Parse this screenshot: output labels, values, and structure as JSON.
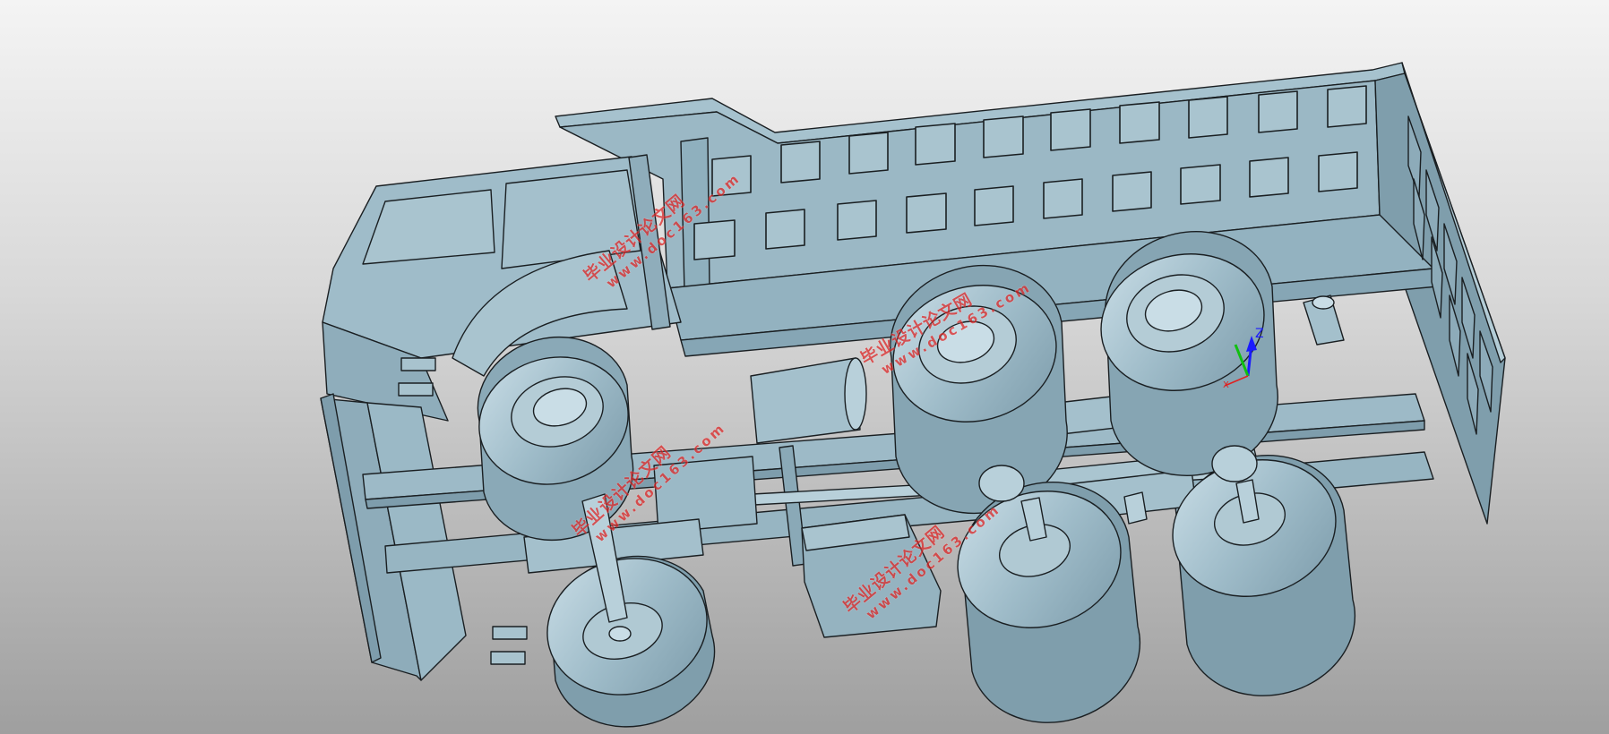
{
  "viewport": {
    "name": "3D CAD model viewport",
    "model": "dump-truck-assembly"
  },
  "triad": {
    "z_label": "Z",
    "x_label": "X",
    "z_color": "#1a1aff",
    "x_color": "#e02020",
    "y_color": "#10c010"
  },
  "colors": {
    "model_fill": "#9fbcc9",
    "model_fill_dark": "#7f9ead",
    "model_fill_light": "#c6dbe4",
    "edge": "#1a1f22",
    "watermark": "#dd2222"
  },
  "watermarks": [
    {
      "line1": "毕业设计论文网",
      "line2": "www.doc163.com"
    },
    {
      "line1": "毕业设计论文网",
      "line2": "www.doc163.com"
    },
    {
      "line1": "毕业设计论文网",
      "line2": "www.doc163.com"
    },
    {
      "line1": "毕业设计论文网",
      "line2": "www.doc163.com"
    }
  ]
}
